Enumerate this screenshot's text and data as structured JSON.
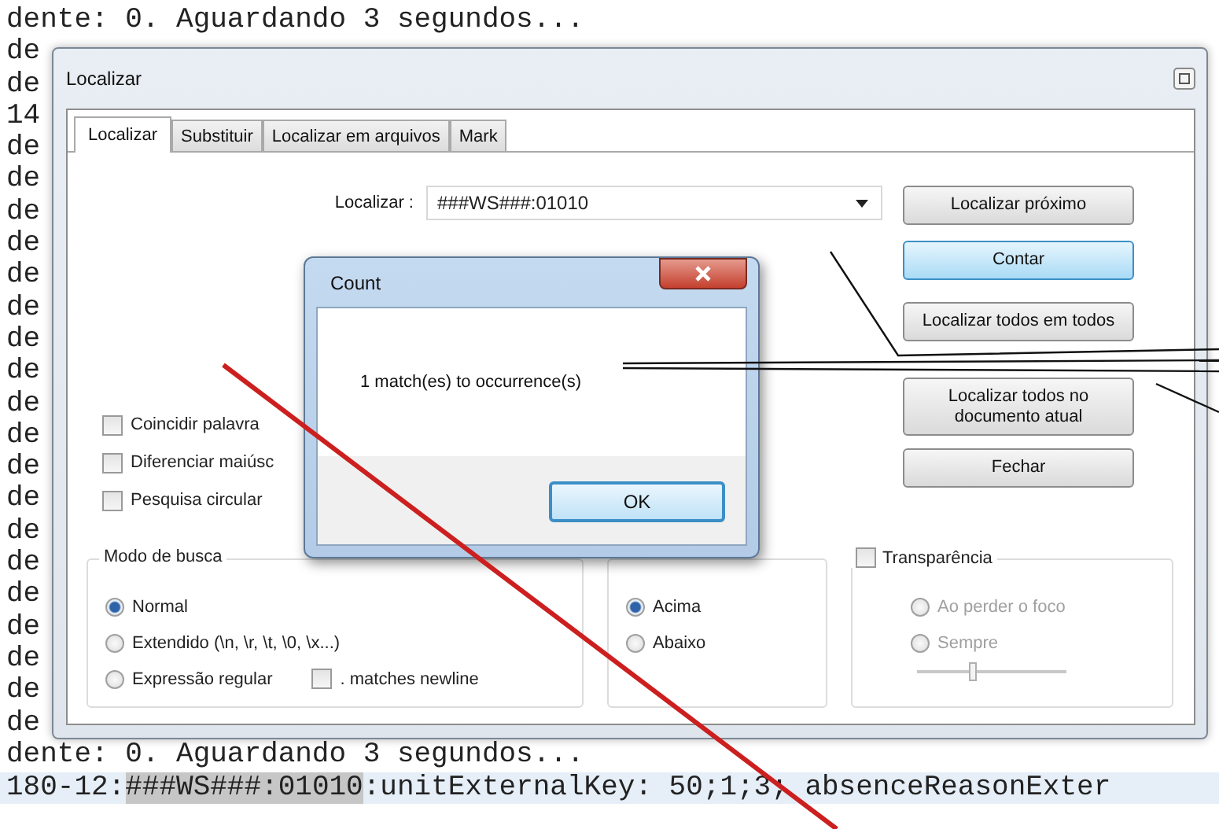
{
  "editor": {
    "lines": [
      {
        "current": false,
        "segments": [
          {
            "text": "dente: 0. Aguardando 3 segundos...",
            "match": false
          }
        ]
      },
      {
        "current": false,
        "segments": [
          {
            "text": "de",
            "match": false
          }
        ]
      },
      {
        "current": false,
        "segments": [
          {
            "text": "de",
            "match": false
          }
        ]
      },
      {
        "current": false,
        "segments": [
          {
            "text": "14",
            "match": false
          }
        ]
      },
      {
        "current": false,
        "segments": [
          {
            "text": "de",
            "match": false
          }
        ]
      },
      {
        "current": false,
        "segments": [
          {
            "text": "de",
            "match": false
          }
        ]
      },
      {
        "current": false,
        "segments": [
          {
            "text": "de",
            "match": false
          }
        ]
      },
      {
        "current": false,
        "segments": [
          {
            "text": "de",
            "match": false
          }
        ]
      },
      {
        "current": false,
        "segments": [
          {
            "text": "de",
            "match": false
          }
        ]
      },
      {
        "current": false,
        "segments": [
          {
            "text": "de",
            "match": false
          }
        ]
      },
      {
        "current": false,
        "segments": [
          {
            "text": "de",
            "match": false
          }
        ]
      },
      {
        "current": false,
        "segments": [
          {
            "text": "de",
            "match": false
          }
        ]
      },
      {
        "current": false,
        "segments": [
          {
            "text": "de",
            "match": false
          }
        ]
      },
      {
        "current": false,
        "segments": [
          {
            "text": "de",
            "match": false
          }
        ]
      },
      {
        "current": false,
        "segments": [
          {
            "text": "de",
            "match": false
          }
        ]
      },
      {
        "current": false,
        "segments": [
          {
            "text": "de",
            "match": false
          }
        ]
      },
      {
        "current": false,
        "segments": [
          {
            "text": "de",
            "match": false
          }
        ]
      },
      {
        "current": false,
        "segments": [
          {
            "text": "de",
            "match": false
          }
        ]
      },
      {
        "current": false,
        "segments": [
          {
            "text": "de",
            "match": false
          }
        ]
      },
      {
        "current": false,
        "segments": [
          {
            "text": "de",
            "match": false
          }
        ]
      },
      {
        "current": false,
        "segments": [
          {
            "text": "de",
            "match": false
          }
        ]
      },
      {
        "current": false,
        "segments": [
          {
            "text": "de",
            "match": false
          }
        ]
      },
      {
        "current": false,
        "segments": [
          {
            "text": "de",
            "match": false
          }
        ]
      },
      {
        "current": false,
        "segments": [
          {
            "text": "dente: 0. Aguardando 3 segundos...",
            "match": false
          }
        ]
      },
      {
        "current": true,
        "segments": [
          {
            "text": "180-12:",
            "match": false
          },
          {
            "text": "###WS###:01010",
            "match": true
          },
          {
            "text": ":unitExternalKey: 50;1;3; absenceReasonExter",
            "match": false
          }
        ]
      }
    ]
  },
  "find_dialog": {
    "title": "Localizar",
    "tabs": [
      {
        "label": "Localizar",
        "selected": true
      },
      {
        "label": "Substituir",
        "selected": false
      },
      {
        "label": "Localizar em arquivos",
        "selected": false
      },
      {
        "label": "Mark",
        "selected": false
      }
    ],
    "find_label": "Localizar :",
    "find_value": "###WS###:01010",
    "buttons": [
      {
        "label": "Localizar próximo",
        "focused": false
      },
      {
        "label": "Contar",
        "focused": true
      },
      {
        "label": "Localizar todos em todos",
        "focused": false
      },
      {
        "label": "Localizar todos no documento atual",
        "focused": false
      },
      {
        "label": "Fechar",
        "focused": false
      }
    ],
    "options": [
      {
        "label": "Coincidir palavra",
        "checked": false
      },
      {
        "label": "Diferenciar maiúsc",
        "checked": false
      },
      {
        "label": "Pesquisa circular",
        "checked": false
      }
    ],
    "search_mode": {
      "title": "Modo de busca",
      "options": [
        {
          "label": "Normal",
          "selected": true
        },
        {
          "label": "Extendido  (\\n, \\r, \\t, \\0, \\x...)",
          "selected": false
        },
        {
          "label": "Expressão regular",
          "selected": false
        }
      ],
      "newline_option": {
        "label": ". matches newline",
        "checked": false
      }
    },
    "direction": {
      "options": [
        {
          "label": "Acima",
          "selected": true
        },
        {
          "label": "Abaixo",
          "selected": false
        }
      ]
    },
    "transparency": {
      "label": "Transparência",
      "checked": false,
      "options": [
        {
          "label": "Ao perder o foco",
          "selected": false,
          "disabled": true
        },
        {
          "label": "Sempre",
          "selected": false,
          "disabled": true
        }
      ],
      "level": 0.35
    }
  },
  "count_dialog": {
    "title": "Count",
    "message": "1 match(es) to occurrence(s)",
    "ok": "OK"
  }
}
